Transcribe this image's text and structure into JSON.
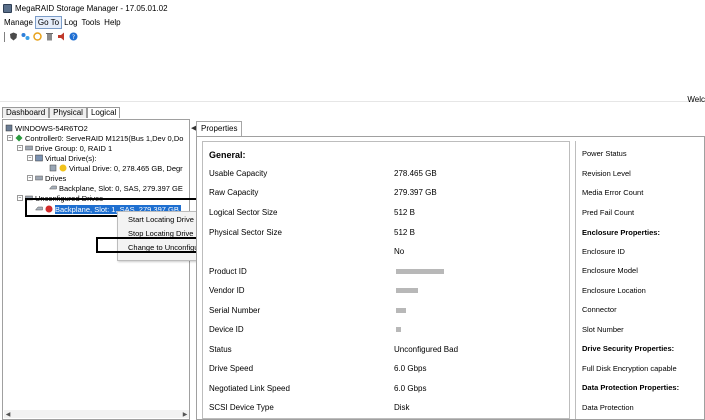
{
  "window": {
    "title": "MegaRAID Storage Manager - 17.05.01.02"
  },
  "menu": [
    "Manage",
    "Go To",
    "Log",
    "Tools",
    "Help"
  ],
  "toolbar_icons": [
    "shield-icon",
    "network-icon",
    "refresh-icon",
    "trash-icon",
    "alarm-icon",
    "help-icon"
  ],
  "banner": {
    "right_text": "Welc"
  },
  "tabs": [
    "Dashboard",
    "Physical",
    "Logical"
  ],
  "tree": {
    "server": "WINDOWS-54R6TO2",
    "controller": "Controller0: ServeRAID M1215(Bus 1,Dev 0,Do",
    "drive_group": "Drive Group: 0, RAID  1",
    "virtual_drives_label": "Virtual Drive(s):",
    "virtual_drive": "Virtual Drive: 0, 278.465 GB, Degr",
    "drives_label": "Drives",
    "drive": "Backplane, Slot: 0, SAS, 279.397 GE",
    "unconfigured_label": "Unconfigured Drives",
    "unconfigured_drive": "Backplane, Slot: 1, SAS, 279.397 GB"
  },
  "context_menu": {
    "start_locating": "Start Locating Drive",
    "stop_locating": "Stop Locating Drive",
    "change_unconfigured": "Change to Unconfigured Good"
  },
  "properties": {
    "tab": "Properties",
    "general_header": "General:",
    "rows": [
      {
        "label": "Usable Capacity",
        "value": "278.465 GB"
      },
      {
        "label": "Raw Capacity",
        "value": "279.397 GB"
      },
      {
        "label": "Logical Sector Size",
        "value": "512 B"
      },
      {
        "label": "Physical Sector Size",
        "value": "512 B"
      },
      {
        "label": "",
        "value": "No"
      },
      {
        "label": "Product ID",
        "value": ""
      },
      {
        "label": "Vendor ID",
        "value": ""
      },
      {
        "label": "Serial Number",
        "value": ""
      },
      {
        "label": "Device ID",
        "value": ""
      },
      {
        "label": "Status",
        "value": "Unconfigured Bad"
      },
      {
        "label": "Drive Speed",
        "value": "6.0 Gbps"
      },
      {
        "label": "Negotiated Link Speed",
        "value": "6.0 Gbps"
      },
      {
        "label": "SCSI Device Type",
        "value": "Disk"
      }
    ],
    "right_rows": [
      {
        "label": "Power Status",
        "bold": false
      },
      {
        "label": "Revision Level",
        "bold": false
      },
      {
        "label": "Media Error Count",
        "bold": false
      },
      {
        "label": "Pred Fail Count",
        "bold": false
      },
      {
        "label": "Enclosure Properties:",
        "bold": true
      },
      {
        "label": "Enclosure ID",
        "bold": false
      },
      {
        "label": "Enclosure Model",
        "bold": false
      },
      {
        "label": "Enclosure Location",
        "bold": false
      },
      {
        "label": "Connector",
        "bold": false
      },
      {
        "label": "Slot Number",
        "bold": false
      },
      {
        "label": "Drive Security Properties:",
        "bold": true
      },
      {
        "label": "Full Disk Encryption capable",
        "bold": false
      },
      {
        "label": "Data Protection Properties:",
        "bold": true
      },
      {
        "label": "Data Protection",
        "bold": false
      }
    ]
  }
}
